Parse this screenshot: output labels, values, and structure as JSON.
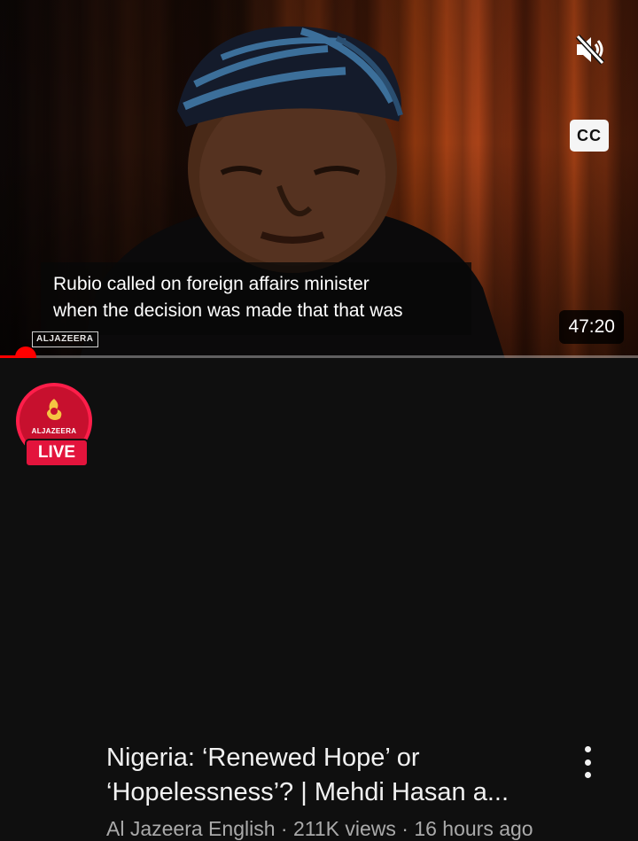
{
  "player": {
    "captions": [
      "Rubio called on foreign affairs minister",
      "when the decision was made that that was"
    ],
    "watermark": "ALJAZEERA",
    "duration": "47:20",
    "cc_label": "CC",
    "mute_icon": "volume-muted-icon",
    "progress_fraction": 0.04
  },
  "video": {
    "title_lines": [
      "Nigeria: ‘Renewed Hope’ or",
      "‘Hopelessness’? | Mehdi Hasan a..."
    ],
    "channel": "Al Jazeera English",
    "views": "211K views",
    "age": "16 hours ago",
    "separator": "·"
  },
  "avatar": {
    "brand": "ALJAZEERA",
    "live_label": "LIVE",
    "ring_color": "#ff1e4a"
  },
  "colors": {
    "accent": "#ff0000",
    "background": "#0f0f0f",
    "secondary_text": "#aaaaaa"
  }
}
